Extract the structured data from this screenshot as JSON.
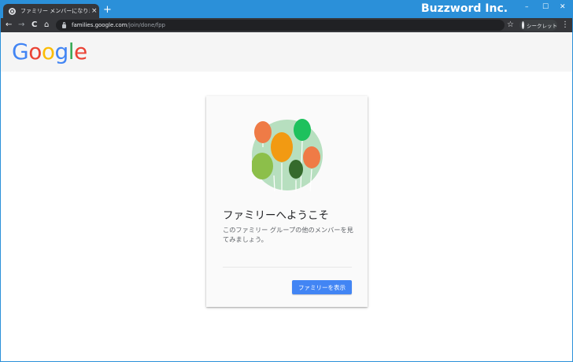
{
  "browser": {
    "tab_title": "ファミリー メンバーになりました",
    "tab_close": "×",
    "new_tab": "+",
    "brand_watermark": "Buzzword Inc.",
    "window_minimize": "–",
    "window_maximize": "☐",
    "window_close": "✕",
    "nav_back": "←",
    "nav_forward": "→",
    "nav_reload": "C",
    "nav_home": "⌂",
    "url_domain": "families.google.com",
    "url_path": "/join/done/fpp",
    "bookmark_star": "☆",
    "incognito_label": "シークレット",
    "menu": "⋮"
  },
  "header": {
    "logo_letters": [
      {
        "char": "G",
        "color": "#4285f4"
      },
      {
        "char": "o",
        "color": "#ea4335"
      },
      {
        "char": "o",
        "color": "#fbbc05"
      },
      {
        "char": "g",
        "color": "#4285f4"
      },
      {
        "char": "l",
        "color": "#34a853"
      },
      {
        "char": "e",
        "color": "#ea4335"
      }
    ]
  },
  "card": {
    "illustration": "balloons-illustration",
    "title": "ファミリーへようこそ",
    "description": "このファミリー グループの他のメンバーを見てみましょう。",
    "button_label": "ファミリーを表示"
  },
  "colors": {
    "frame": "#2b90d9",
    "chrome_dark": "#35363a",
    "button_blue": "#4285f4"
  }
}
